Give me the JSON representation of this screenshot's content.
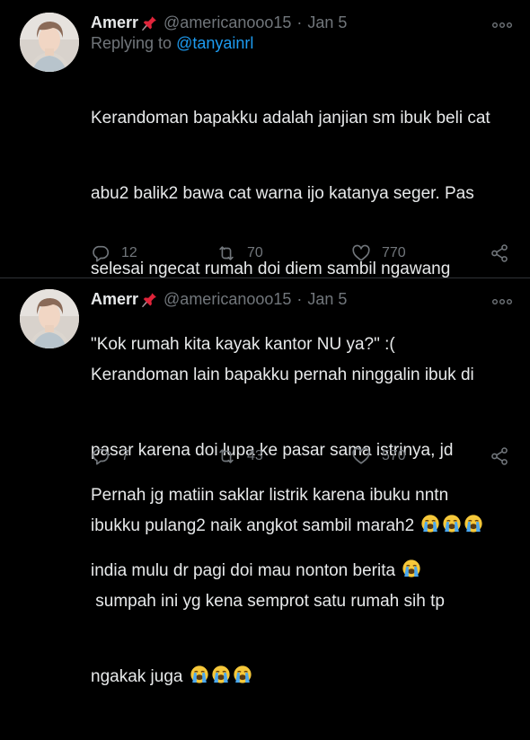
{
  "tweets": [
    {
      "display_name": "Amerr",
      "handle": "@americanooo15",
      "separator": "·",
      "date": "Jan 5",
      "reply_prefix": "Replying to ",
      "reply_mention": "@tanyainrl",
      "text_lines": [
        "Kerandoman bapakku adalah janjian sm ibuk beli cat",
        "abu2 balik2 bawa cat warna ijo katanya seger. Pas",
        "selesai ngecat rumah doi diem sambil ngawang",
        "\"Kok rumah kita kayak kantor NU ya?\" :(",
        "",
        "Pernah jg matiin saklar listrik karena ibuku nntn",
        "india mulu dr pagi doi mau nonton berita"
      ],
      "replies": "12",
      "retweets": "70",
      "likes": "770"
    },
    {
      "display_name": "Amerr",
      "handle": "@americanooo15",
      "separator": "·",
      "date": "Jan 5",
      "text_lines": [
        "Kerandoman lain bapakku pernah ninggalin ibuk di",
        "pasar karena doi lupa ke pasar sama istrinya, jd",
        "ibukku pulang2 naik angkot sambil marah2",
        " sumpah ini yg kena semprot satu rumah sih tp",
        "ngakak juga"
      ],
      "replies": "7",
      "retweets": "43",
      "likes": "570"
    }
  ],
  "icons": {
    "pin": "pushpin-emoji",
    "crying": "loudly-crying-face-emoji",
    "more": "more-dots-icon",
    "reply": "reply-icon",
    "retweet": "retweet-icon",
    "like": "heart-icon",
    "share": "share-icon"
  },
  "colors": {
    "background": "#000000",
    "text": "#e7e9ea",
    "secondary": "#71767b",
    "link": "#1d9bf0",
    "line": "#2f3336"
  }
}
